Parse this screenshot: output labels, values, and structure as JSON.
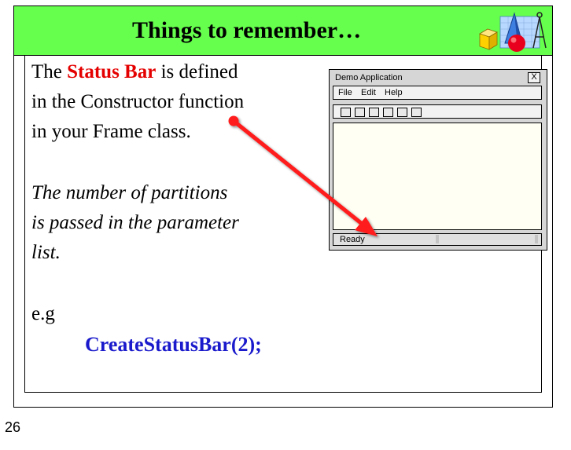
{
  "slide": {
    "title": "Things to remember…",
    "paragraph1": {
      "line1_pre": "The ",
      "line1_highlight": "Status Bar",
      "line1_post": " is defined",
      "line2": "in the Constructor function",
      "line3": "in your Frame class."
    },
    "paragraph2": {
      "line1": "The number of partitions",
      "line2": "is passed in the parameter",
      "line3": "list."
    },
    "example_label": "e.g",
    "code": "CreateStatusBar(2);"
  },
  "demo_window": {
    "title": "Demo Application",
    "close_label": "X",
    "menu": [
      "File",
      "Edit",
      "Help"
    ],
    "toolbar_button_count": 6,
    "status_text": "Ready"
  },
  "colors": {
    "title_bar": "#66ff4d",
    "highlight": "#e50000",
    "code": "#1a1acc",
    "arrow": "#ff1a1a"
  },
  "footer": {
    "page_number": "26"
  }
}
